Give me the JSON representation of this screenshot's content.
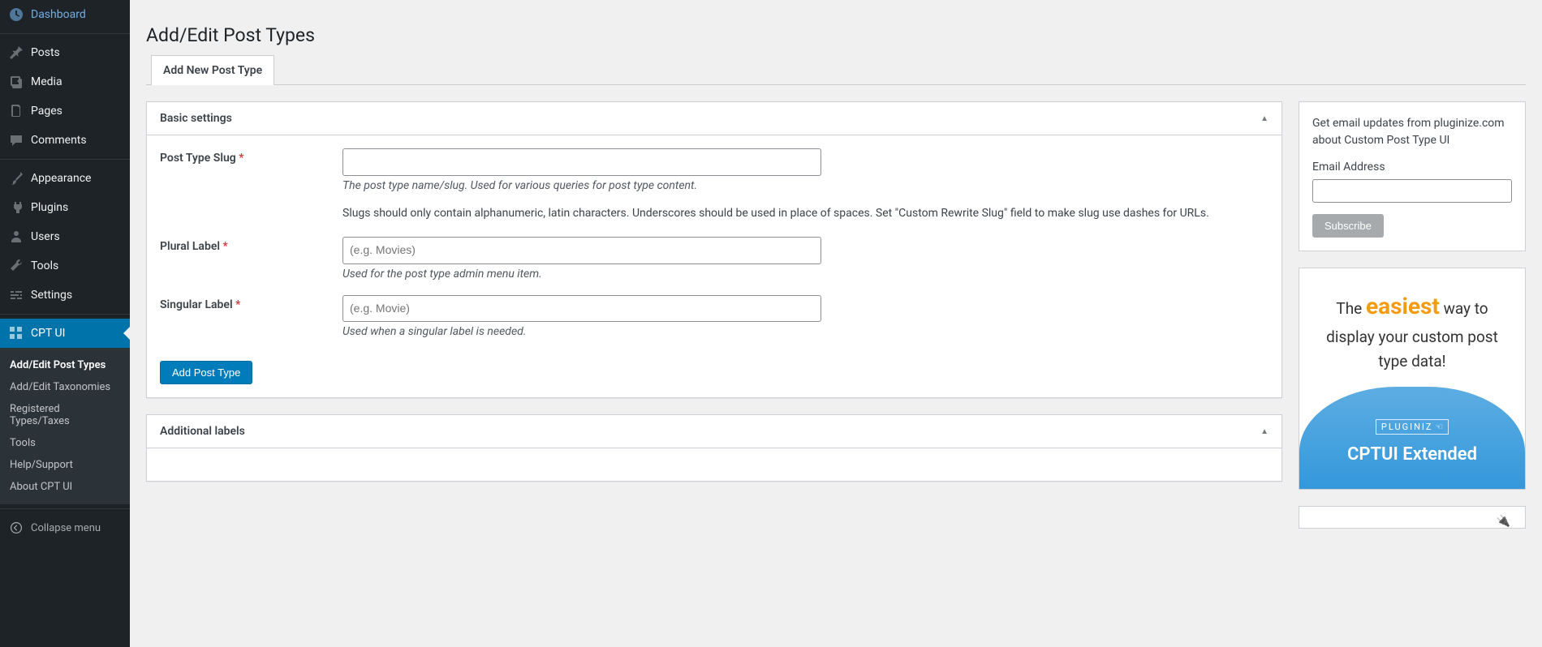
{
  "sidebar": {
    "items": [
      {
        "label": "Dashboard",
        "icon": "dashboard"
      },
      {
        "label": "Posts",
        "icon": "pin"
      },
      {
        "label": "Media",
        "icon": "media"
      },
      {
        "label": "Pages",
        "icon": "page"
      },
      {
        "label": "Comments",
        "icon": "comment"
      },
      {
        "label": "Appearance",
        "icon": "brush"
      },
      {
        "label": "Plugins",
        "icon": "plug"
      },
      {
        "label": "Users",
        "icon": "user"
      },
      {
        "label": "Tools",
        "icon": "wrench"
      },
      {
        "label": "Settings",
        "icon": "sliders"
      },
      {
        "label": "CPT UI",
        "icon": "cpt"
      }
    ],
    "submenu": [
      "Add/Edit Post Types",
      "Add/Edit Taxonomies",
      "Registered Types/Taxes",
      "Tools",
      "Help/Support",
      "About CPT UI"
    ],
    "collapse": "Collapse menu"
  },
  "page": {
    "title": "Add/Edit Post Types"
  },
  "tab": {
    "label": "Add New Post Type"
  },
  "basic": {
    "heading": "Basic settings",
    "slug_label": "Post Type Slug",
    "slug_desc": "The post type name/slug. Used for various queries for post type content.",
    "slug_note": "Slugs should only contain alphanumeric, latin characters. Underscores should be used in place of spaces. Set \"Custom Rewrite Slug\" field to make slug use dashes for URLs.",
    "plural_label": "Plural Label",
    "plural_placeholder": "(e.g. Movies)",
    "plural_desc": "Used for the post type admin menu item.",
    "singular_label": "Singular Label",
    "singular_placeholder": "(e.g. Movie)",
    "singular_desc": "Used when a singular label is needed.",
    "submit": "Add Post Type"
  },
  "additional": {
    "heading": "Additional labels"
  },
  "newsletter": {
    "text": "Get email updates from pluginize.com about Custom Post Type UI",
    "email_label": "Email Address",
    "subscribe": "Subscribe"
  },
  "promo": {
    "line1": "The",
    "easiest": "easiest",
    "line2": "way to display your custom post type data!",
    "brand": "PLUGINIZ",
    "product": "CPTUI Extended"
  }
}
